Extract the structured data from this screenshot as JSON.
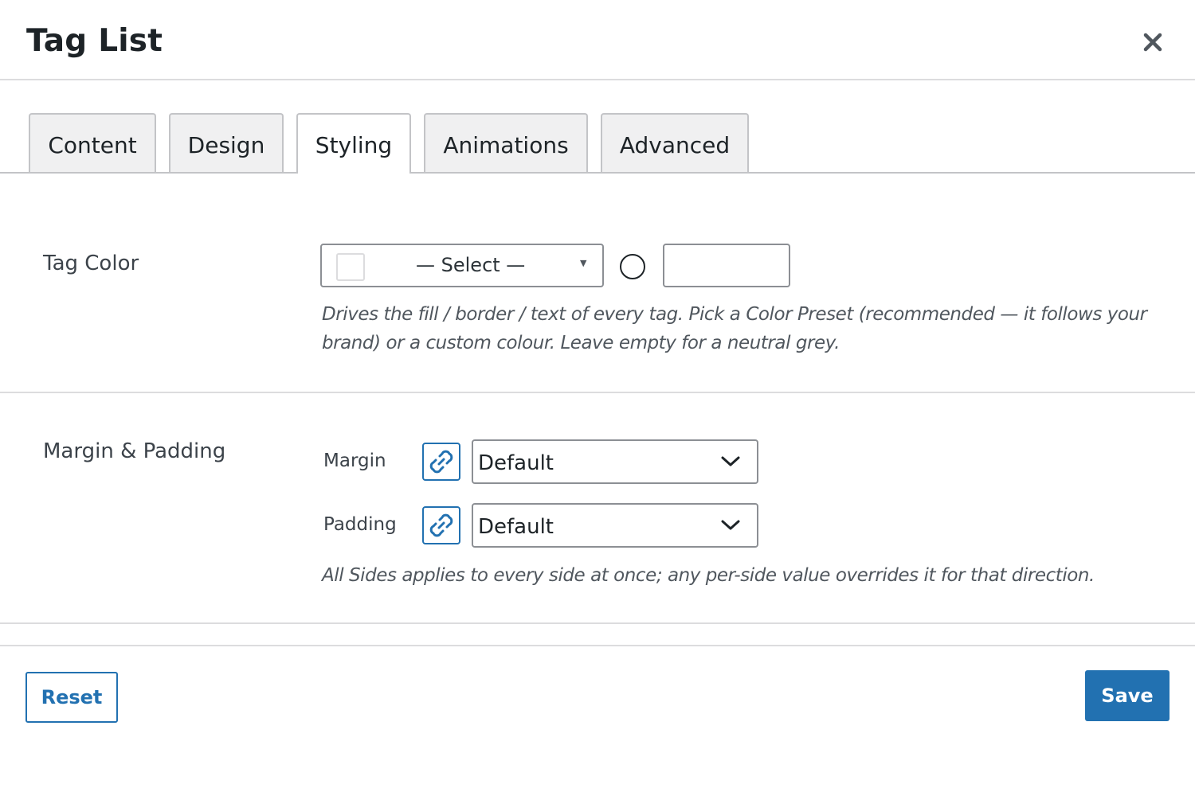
{
  "dialog": {
    "title": "Tag List"
  },
  "tabs": [
    {
      "label": "Content"
    },
    {
      "label": "Design"
    },
    {
      "label": "Styling",
      "active": true
    },
    {
      "label": "Animations"
    },
    {
      "label": "Advanced"
    }
  ],
  "tag_color": {
    "label": "Tag Color",
    "select_placeholder": "— Select —",
    "hex_value": "",
    "help": "Drives the fill / border / text of every tag. Pick a Color Preset (recommended — it follows your brand) or a custom colour. Leave empty for a neutral grey."
  },
  "spacing": {
    "label": "Margin & Padding",
    "margin": {
      "label": "Margin",
      "value": "Default"
    },
    "padding": {
      "label": "Padding",
      "value": "Default"
    },
    "help": "All Sides applies to every side at once; any per-side value overrides it for that direction."
  },
  "footer": {
    "reset_label": "Reset",
    "save_label": "Save"
  },
  "colors": {
    "accent": "#2271b1",
    "border": "#8c8f94",
    "tab_bg": "#f0f0f1",
    "text": "#1d2327"
  },
  "icons": {
    "close": "close-icon",
    "link": "link-icon",
    "chevron": "chevron-down-icon",
    "caret": "caret-down-icon"
  }
}
